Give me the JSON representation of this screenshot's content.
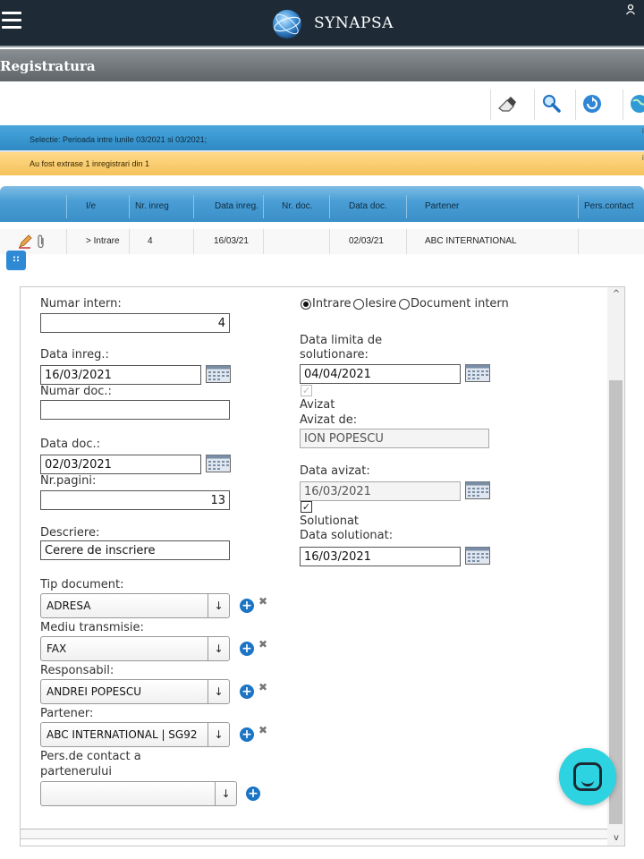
{
  "app": {
    "title": "SYNAPSA"
  },
  "section": {
    "title": "Registratura"
  },
  "toolbar": {
    "icons": [
      "eraser-icon",
      "search-icon",
      "refresh-icon",
      "globe-icon"
    ]
  },
  "info": {
    "selection": "Selectie: Perioada intre lunile 03/2021 si 03/2021;",
    "extracted": "Au fost extrase 1 inregistrari din 1"
  },
  "table": {
    "columns": [
      "I/e",
      "Nr. inreg",
      "Data inreg.",
      "Nr. doc.",
      "Data doc.",
      "Partener",
      "Pers.contact"
    ],
    "rows": [
      {
        "ie": "> Intrare",
        "nr_inreg": "4",
        "data_inreg": "16/03/21",
        "nr_doc": "",
        "data_doc": "02/03/21",
        "partener": "ABC INTERNATIONAL",
        "pers_contact": ""
      }
    ]
  },
  "form": {
    "numar_intern": {
      "label": "Numar intern:",
      "value": "4"
    },
    "data_inreg": {
      "label": "Data inreg.:",
      "value": "16/03/2021"
    },
    "numar_doc": {
      "label": "Numar doc.:",
      "value": ""
    },
    "data_doc": {
      "label": "Data doc.:",
      "value": "02/03/2021"
    },
    "nr_pagini": {
      "label": "Nr.pagini:",
      "value": "13"
    },
    "descriere": {
      "label": "Descriere:",
      "value": "Cerere de inscriere"
    },
    "tip_document": {
      "label": "Tip document:",
      "value": "ADRESA"
    },
    "mediu_transmisie": {
      "label": "Mediu transmisie:",
      "value": "FAX"
    },
    "responsabil": {
      "label": "Responsabil:",
      "value": "ANDREI POPESCU"
    },
    "partener": {
      "label": "Partener:",
      "value": "ABC INTERNATIONAL | SG92"
    },
    "pers_contact": {
      "label_line1": "Pers.de contact a",
      "label_line2": "partenerului",
      "value": ""
    },
    "direction": {
      "options": [
        "Intrare",
        "Iesire",
        "Document intern"
      ],
      "selected": "Intrare"
    },
    "data_limita": {
      "label_line1": "Data limita de",
      "label_line2": "solutionare:",
      "value": "04/04/2021"
    },
    "avizat": {
      "label": "Avizat",
      "checked": true
    },
    "avizat_de": {
      "label": "Avizat de:",
      "value": "ION POPESCU"
    },
    "data_avizat": {
      "label": "Data avizat:",
      "value": "16/03/2021"
    },
    "solutionat": {
      "label": "Solutionat",
      "checked": true
    },
    "data_solutionat": {
      "label": "Data solutionat:",
      "value": "16/03/2021"
    }
  }
}
